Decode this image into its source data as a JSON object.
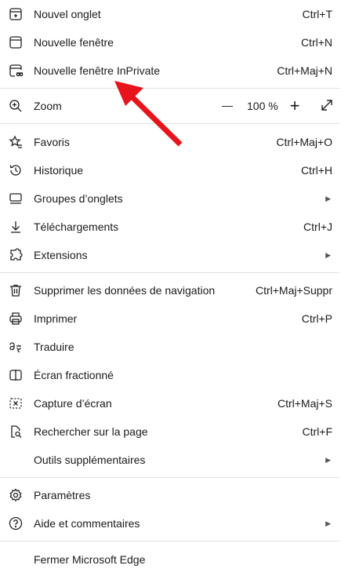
{
  "menu": {
    "new_tab": {
      "label": "Nouvel onglet",
      "shortcut": "Ctrl+T"
    },
    "new_window": {
      "label": "Nouvelle fenêtre",
      "shortcut": "Ctrl+N"
    },
    "new_inprivate": {
      "label": "Nouvelle fenêtre InPrivate",
      "shortcut": "Ctrl+Maj+N"
    },
    "zoom": {
      "label": "Zoom",
      "value": "100 %",
      "minus": "—",
      "plus": "+"
    },
    "favorites": {
      "label": "Favoris",
      "shortcut": "Ctrl+Maj+O"
    },
    "history": {
      "label": "Historique",
      "shortcut": "Ctrl+H"
    },
    "tab_groups": {
      "label": "Groupes d’onglets"
    },
    "downloads": {
      "label": "Téléchargements",
      "shortcut": "Ctrl+J"
    },
    "extensions": {
      "label": "Extensions"
    },
    "clear_data": {
      "label": "Supprimer les données de navigation",
      "shortcut": "Ctrl+Maj+Suppr"
    },
    "print": {
      "label": "Imprimer",
      "shortcut": "Ctrl+P"
    },
    "translate": {
      "label": "Traduire"
    },
    "split_screen": {
      "label": "Écran fractionné"
    },
    "screenshot": {
      "label": "Capture d’écran",
      "shortcut": "Ctrl+Maj+S"
    },
    "find": {
      "label": "Rechercher sur la page",
      "shortcut": "Ctrl+F"
    },
    "more_tools": {
      "label": "Outils supplémentaires"
    },
    "settings": {
      "label": "Paramètres"
    },
    "help": {
      "label": "Aide et commentaires"
    },
    "close": {
      "label": "Fermer Microsoft Edge"
    }
  },
  "submenu_glyph": "▶",
  "icons": [
    "new-tab-icon",
    "new-window-icon",
    "inprivate-icon",
    "zoom-icon",
    "favorites-icon",
    "history-icon",
    "tab-groups-icon",
    "downloads-icon",
    "extensions-icon",
    "trash-icon",
    "print-icon",
    "translate-icon",
    "split-screen-icon",
    "screenshot-icon",
    "find-icon",
    "settings-icon",
    "help-icon",
    "fullscreen-icon"
  ],
  "colors": {
    "annotation_arrow": "#e8141b",
    "separator": "#e1e1e1",
    "text": "#1b1b1b"
  }
}
